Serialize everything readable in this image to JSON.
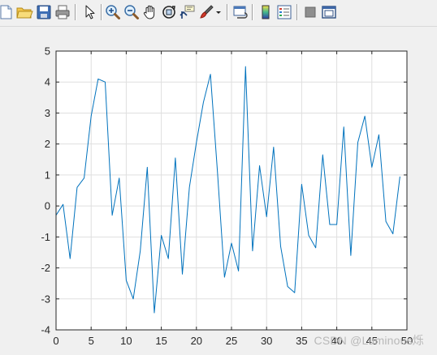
{
  "toolbar": {
    "icons": [
      "new-file-icon",
      "open-folder-icon",
      "save-icon",
      "print-icon",
      "pointer-icon",
      "zoom-in-icon",
      "zoom-out-icon",
      "pan-hand-icon",
      "rotate-3d-icon",
      "data-cursor-icon",
      "brush-icon",
      "brush-dropdown-icon",
      "link-plot-icon",
      "colorbar-icon",
      "legend-icon",
      "hide-plot-tools-icon",
      "show-plot-tools-icon"
    ]
  },
  "chart_data": {
    "type": "line",
    "title": "",
    "xlabel": "",
    "ylabel": "",
    "xlim": [
      0,
      50
    ],
    "ylim": [
      -4,
      5
    ],
    "xticks": [
      0,
      5,
      10,
      15,
      20,
      25,
      30,
      35,
      40,
      45,
      50
    ],
    "yticks": [
      -4,
      -3,
      -2,
      -1,
      0,
      1,
      2,
      3,
      4,
      5
    ],
    "grid": true,
    "color": "#0072bd",
    "series": [
      {
        "x": [
          0,
          1,
          2,
          3,
          4,
          5,
          6,
          7,
          8,
          9,
          10,
          11,
          12,
          13,
          14,
          15,
          16,
          17,
          18,
          19,
          20,
          21,
          22,
          23,
          24,
          25,
          26,
          27,
          28,
          29,
          30,
          31,
          32,
          33,
          34,
          35,
          36,
          37,
          38,
          39,
          40,
          41,
          42,
          43,
          44,
          45,
          46,
          47,
          48,
          49
        ],
        "values": [
          -0.3,
          0.05,
          -1.7,
          0.6,
          0.9,
          2.9,
          4.1,
          4.0,
          -0.3,
          0.9,
          -2.4,
          -3.0,
          -1.45,
          1.25,
          -3.45,
          -0.95,
          -1.7,
          1.55,
          -2.2,
          0.6,
          2.05,
          3.35,
          4.25,
          1.1,
          -2.3,
          -1.2,
          -2.1,
          4.5,
          -1.45,
          1.3,
          -0.35,
          1.9,
          -1.3,
          -2.6,
          -2.8,
          0.7,
          -0.95,
          -1.35,
          1.65,
          -0.6,
          -0.6,
          2.55,
          -1.6,
          2.05,
          2.9,
          1.25,
          2.3,
          -0.5,
          -0.9,
          0.95
        ]
      }
    ]
  },
  "watermark": "CSDN @Luminous烁"
}
